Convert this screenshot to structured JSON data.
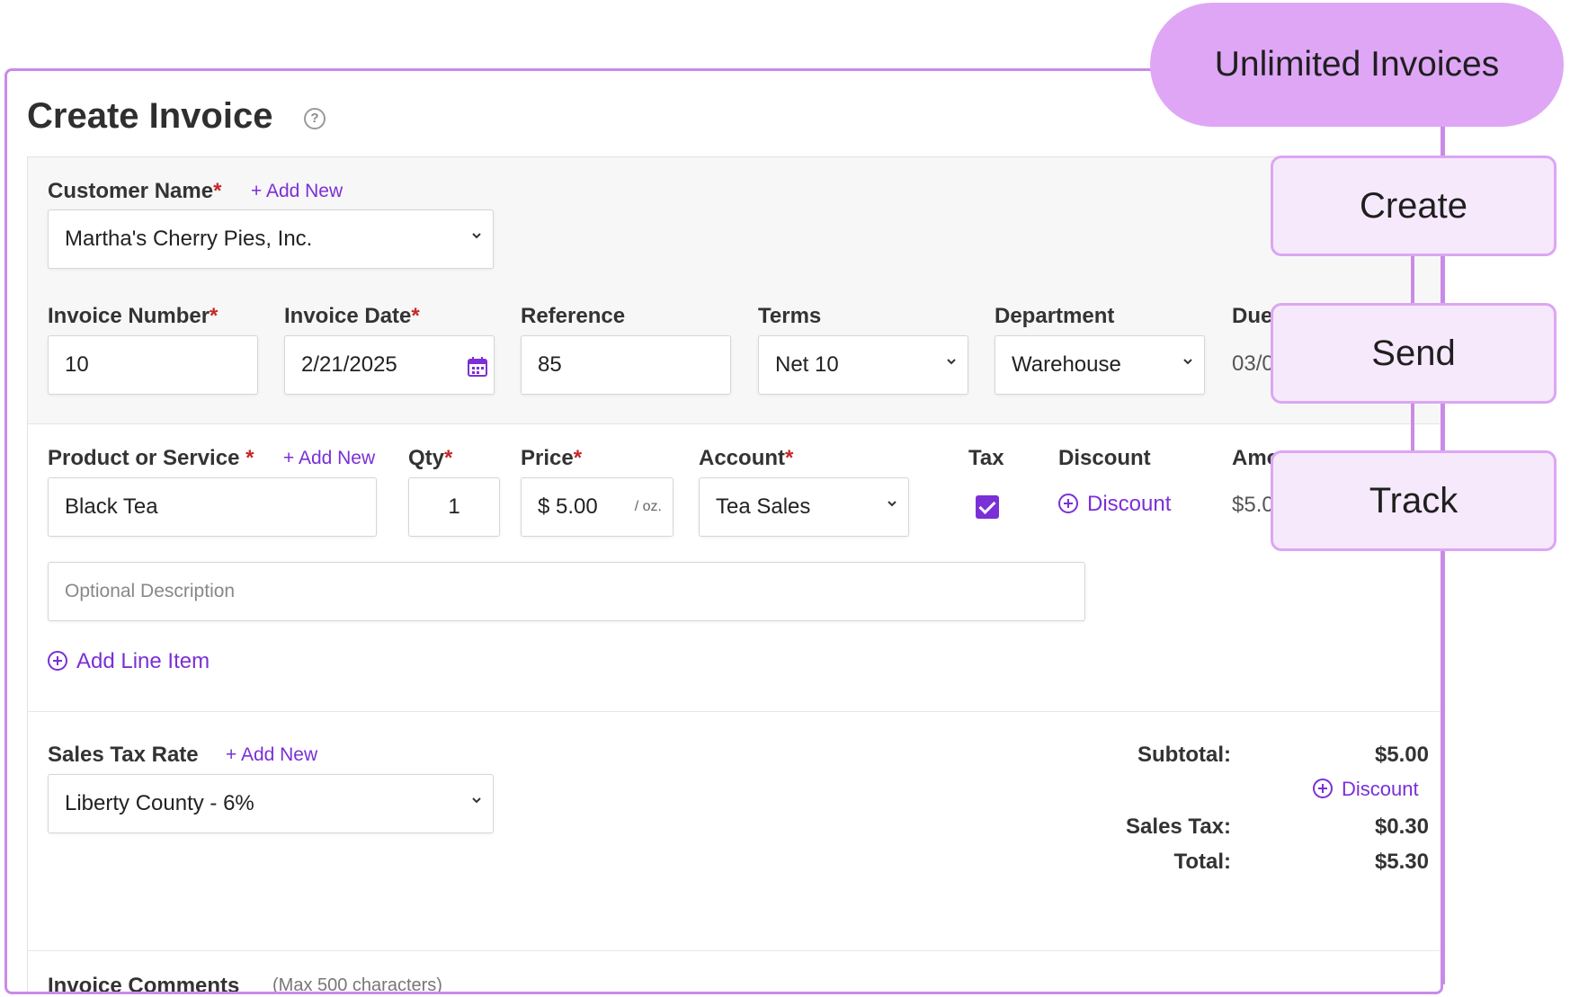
{
  "page": {
    "title": "Create Invoice",
    "help_icon": "question-circle-icon"
  },
  "customer": {
    "label": "Customer Name",
    "required": "*",
    "add_new": "+ Add New",
    "value": "Martha's Cherry Pies, Inc."
  },
  "invoice_fields": {
    "invoice_number": {
      "label": "Invoice Number",
      "required": "*",
      "value": "10"
    },
    "invoice_date": {
      "label": "Invoice Date",
      "required": "*",
      "value": "2/21/2025",
      "icon": "calendar-icon"
    },
    "reference": {
      "label": "Reference",
      "value": "85"
    },
    "terms": {
      "label": "Terms",
      "value": "Net 10"
    },
    "department": {
      "label": "Department",
      "value": "Warehouse"
    },
    "due_date": {
      "label": "Due",
      "value": "03/0"
    }
  },
  "line_item": {
    "product": {
      "label": "Product or Service",
      "required": "*",
      "add_new": "+ Add New",
      "value": "Black Tea"
    },
    "qty": {
      "label": "Qty",
      "required": "*",
      "value": "1"
    },
    "price": {
      "label": "Price",
      "required": "*",
      "currency": "$",
      "value": "5.00",
      "unit": "/ oz."
    },
    "account": {
      "label": "Account",
      "required": "*",
      "value": "Tea Sales"
    },
    "tax": {
      "label": "Tax",
      "checked": true
    },
    "discount": {
      "label": "Discount",
      "link": "Discount"
    },
    "amount": {
      "label": "Amo",
      "value": "$5.0"
    },
    "description_placeholder": "Optional Description"
  },
  "add_line_item": "Add Line Item",
  "sales_tax": {
    "label": "Sales Tax Rate",
    "add_new": "+ Add New",
    "value": "Liberty County - 6%"
  },
  "totals": {
    "subtotal_label": "Subtotal:",
    "subtotal_value": "$5.00",
    "discount_link": "Discount",
    "sales_tax_label": "Sales Tax:",
    "sales_tax_value": "$0.30",
    "total_label": "Total:",
    "total_value": "$5.30"
  },
  "comments": {
    "label": "Invoice Comments",
    "hint": "(Max 500 characters)"
  },
  "callouts": {
    "headline": "Unlimited Invoices",
    "steps": [
      "Create",
      "Send",
      "Track"
    ]
  },
  "colors": {
    "accent": "#7b2fd6",
    "frame": "#c98be6",
    "pill": "#dfa6f6",
    "step_bg": "#f6e9fc"
  }
}
